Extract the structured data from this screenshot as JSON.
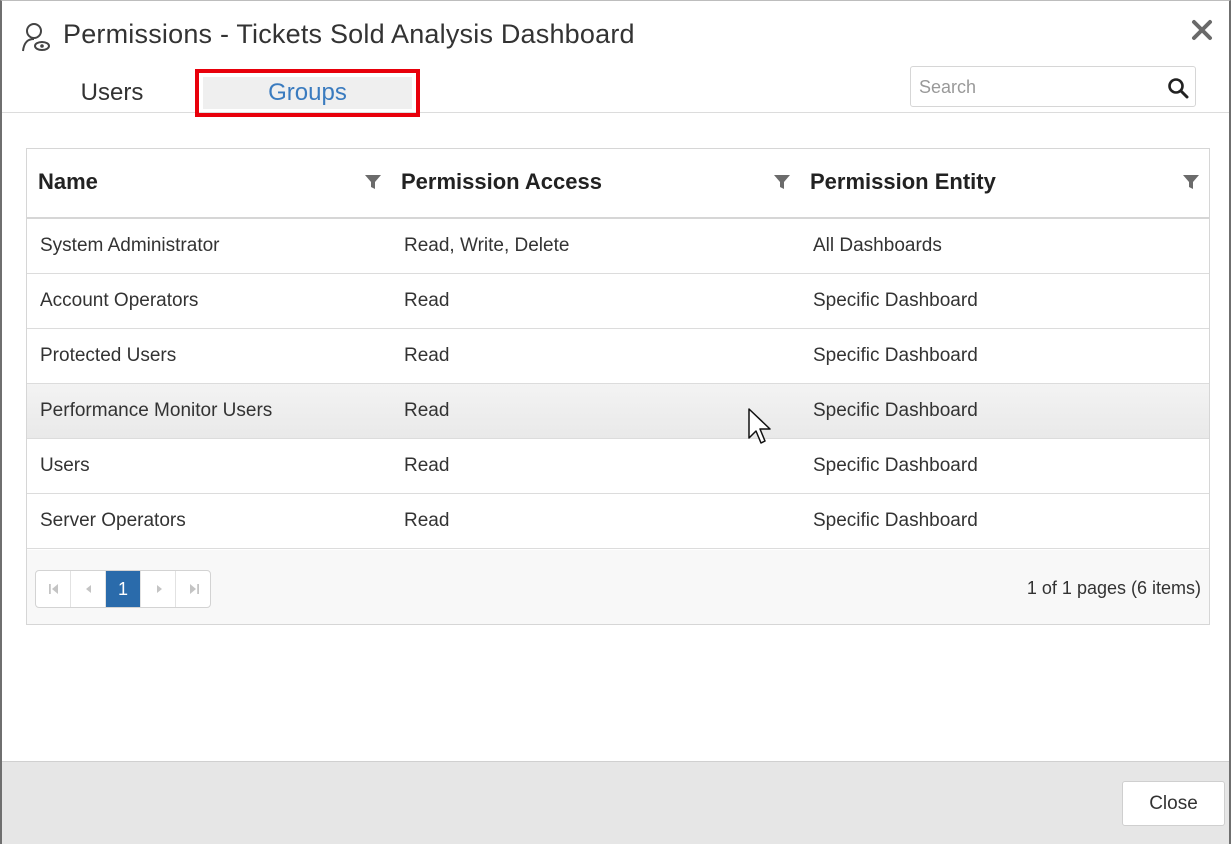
{
  "dialog": {
    "title": "Permissions - Tickets Sold Analysis Dashboard",
    "title_icon": "user-permission-icon",
    "close_icon": "close-icon"
  },
  "tabs": [
    {
      "label": "Users",
      "active": false
    },
    {
      "label": "Groups",
      "active": true
    }
  ],
  "search": {
    "placeholder": "Search",
    "value": ""
  },
  "table": {
    "columns": [
      "Name",
      "Permission Access",
      "Permission Entity"
    ],
    "rows": [
      {
        "name": "System Administrator",
        "access": "Read, Write, Delete",
        "entity": "All Dashboards"
      },
      {
        "name": "Account Operators",
        "access": "Read",
        "entity": "Specific Dashboard"
      },
      {
        "name": "Protected Users",
        "access": "Read",
        "entity": "Specific Dashboard"
      },
      {
        "name": "Performance Monitor Users",
        "access": "Read",
        "entity": "Specific Dashboard"
      },
      {
        "name": "Users",
        "access": "Read",
        "entity": "Specific Dashboard"
      },
      {
        "name": "Server Operators",
        "access": "Read",
        "entity": "Specific Dashboard"
      }
    ],
    "hovered_row": 3
  },
  "pager": {
    "current_page": "1",
    "info": "1 of 1 pages (6 items)"
  },
  "footer": {
    "close_label": "Close"
  },
  "colors": {
    "accent": "#2a6bab",
    "tab_active_text": "#3a7bbf",
    "highlight_box": "#e8000b"
  }
}
